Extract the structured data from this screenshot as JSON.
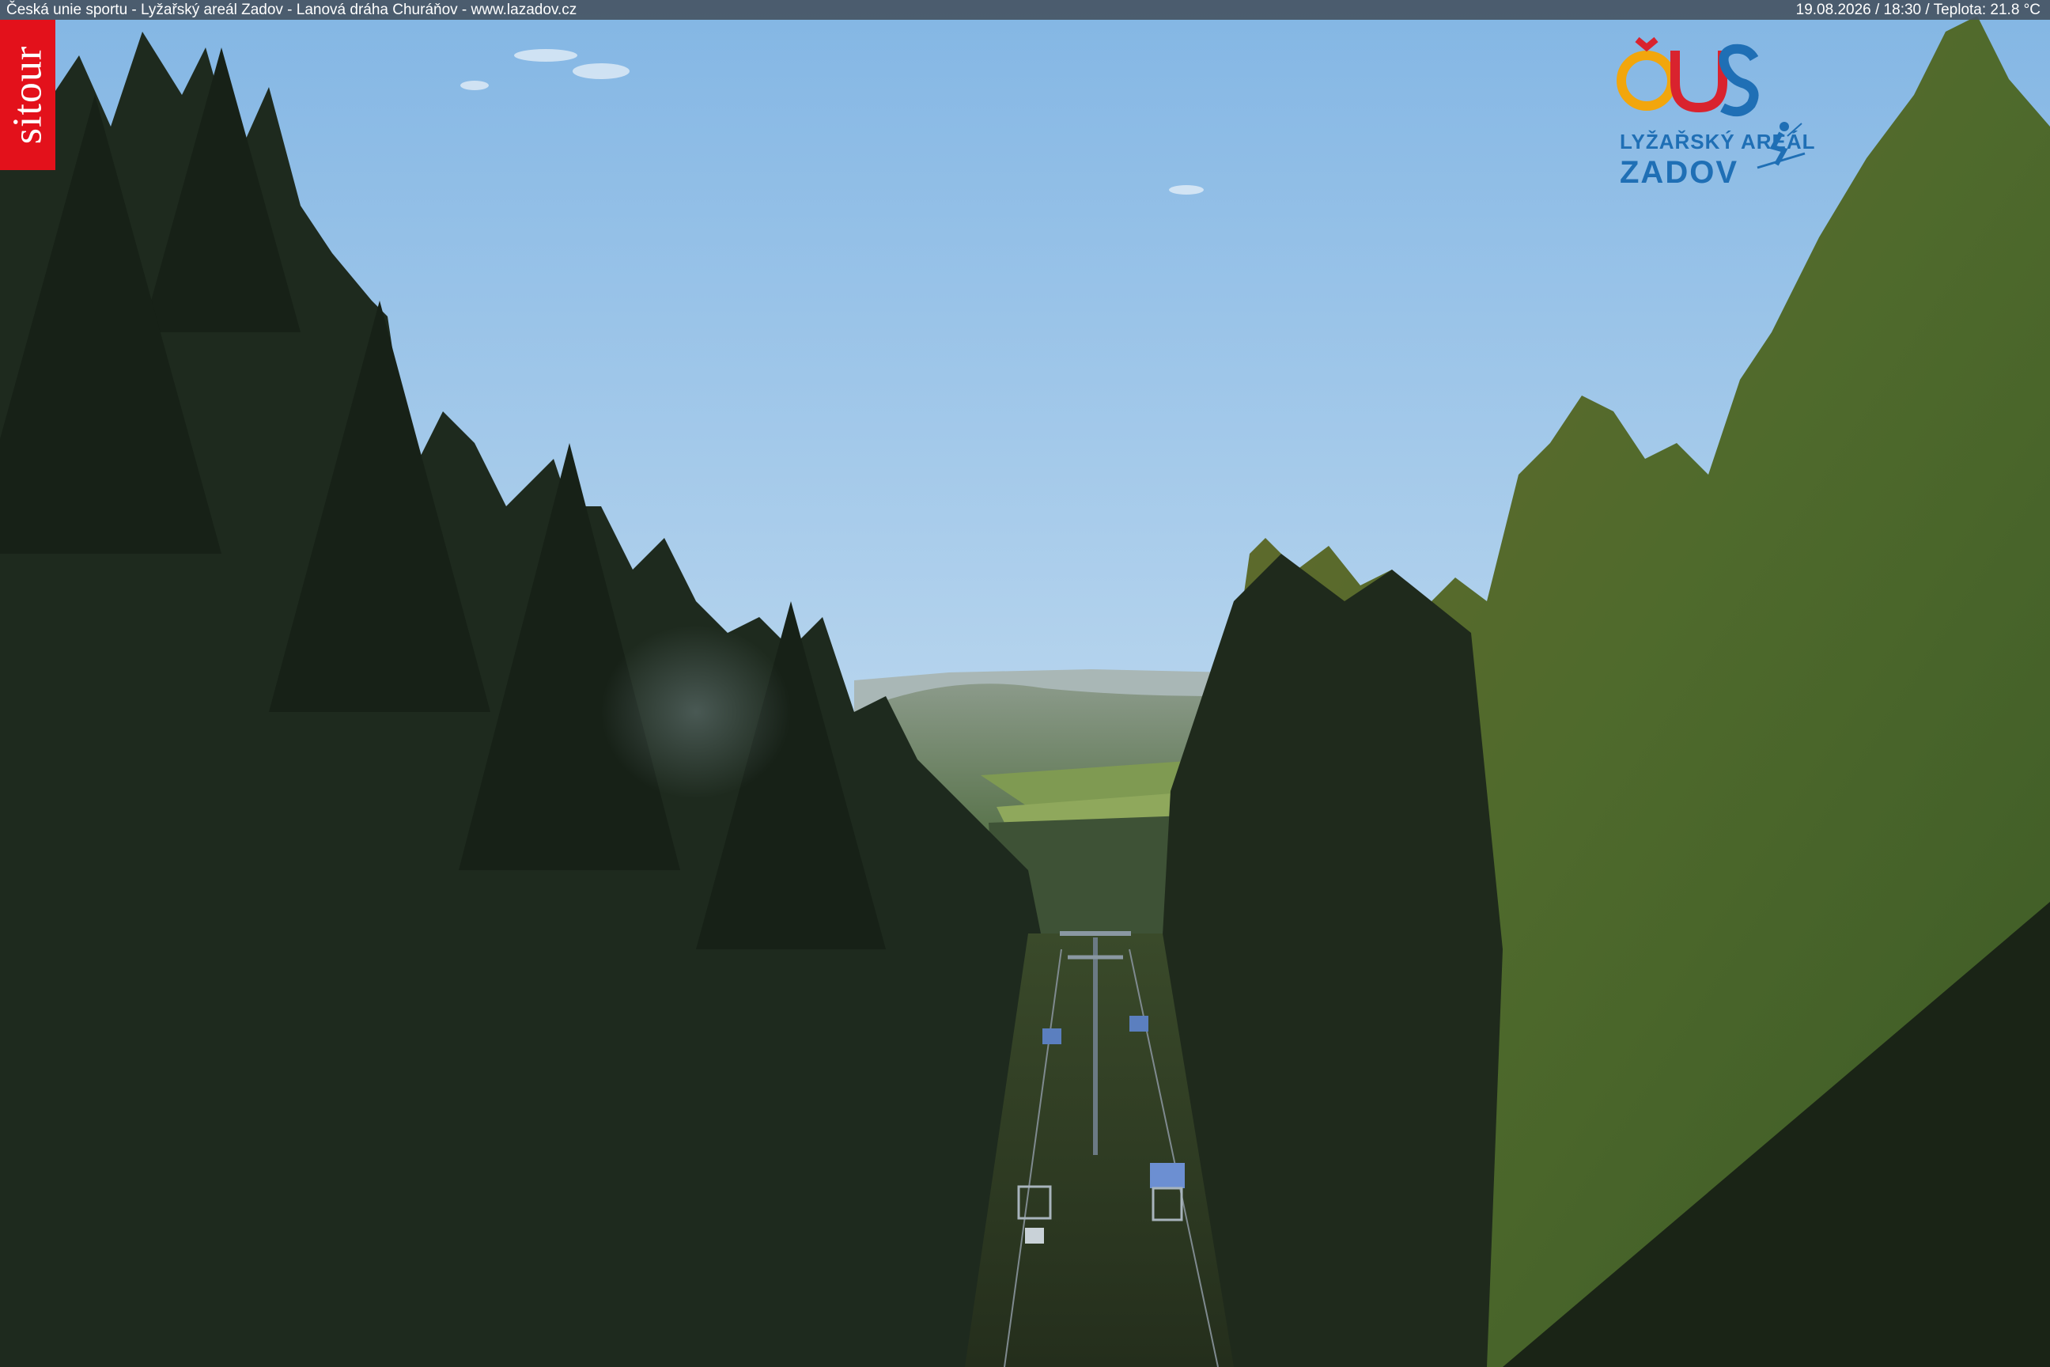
{
  "caption": {
    "left": "Česká unie sportu - Lyžařský areál Zadov - Lanová dráha Churáňov - www.lazadov.cz",
    "right": "19.08.2026 / 18:30 / Teplota: 21.8 °C"
  },
  "badge": {
    "text": "sitour",
    "color": "#e3111b"
  },
  "logo": {
    "mark": "ČUS",
    "line1": "LYŽAŘSKÝ AREÁL",
    "line2": "ZADOV",
    "colors": {
      "primary": "#1f6fb5",
      "accent": "#f2a60c",
      "red": "#d9232e"
    }
  },
  "scene": {
    "description_colors": {
      "sky_top": "#8dbde6",
      "sky_bottom": "#dbe9ee",
      "forest_dark": "#1d2a1c",
      "forest_lit": "#4e6a2a"
    },
    "icons": [
      "chairlift-icon",
      "tree-icon"
    ]
  }
}
